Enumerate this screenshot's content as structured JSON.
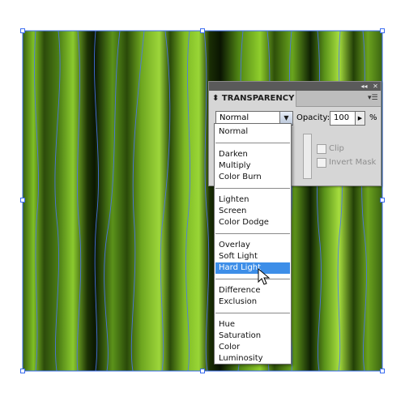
{
  "panel": {
    "tab_title": "TRANSPARENCY",
    "tab_icon": "double-chevron",
    "blend_mode_value": "Normal",
    "opacity_label": "Opacity:",
    "opacity_value": "100",
    "percent_sign": "%",
    "clip_label": "Clip",
    "invert_mask_label": "Invert Mask",
    "collapse_icon": "double-left-chevron-icon",
    "close_icon": "close-icon",
    "menu_icon": "panel-menu-icon"
  },
  "blend_menu": {
    "groups": [
      [
        "Normal"
      ],
      [
        "Darken",
        "Multiply",
        "Color Burn"
      ],
      [
        "Lighten",
        "Screen",
        "Color Dodge"
      ],
      [
        "Overlay",
        "Soft Light",
        "Hard Light"
      ],
      [
        "Difference",
        "Exclusion"
      ],
      [
        "Hue",
        "Saturation",
        "Color",
        "Luminosity"
      ]
    ],
    "highlighted": "Hard Light"
  },
  "colors": {
    "selection_blue": "#3a6cf0",
    "highlight": "#3d8ee8",
    "stripe_dark": "#0a1a02",
    "stripe_light": "#8fcf2a"
  }
}
